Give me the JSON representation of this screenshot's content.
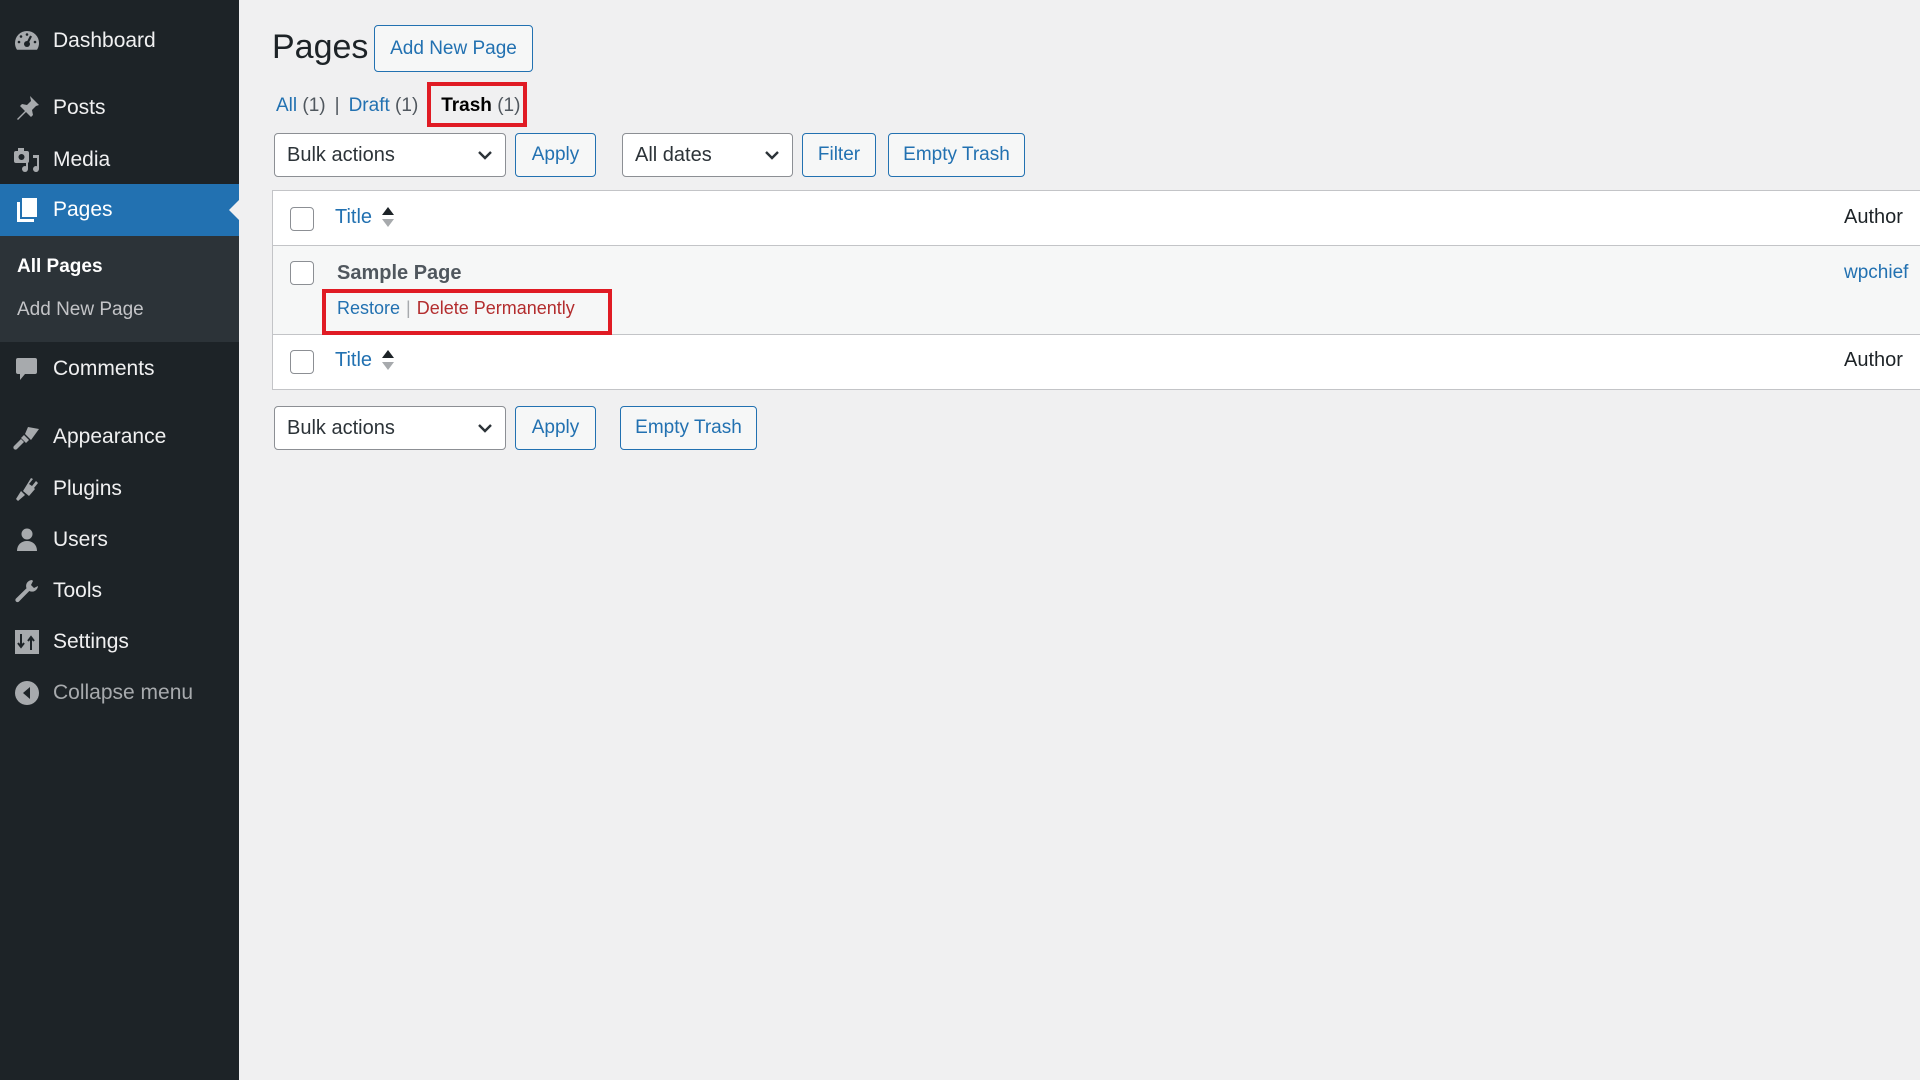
{
  "sidebar": {
    "items": [
      {
        "label": "Dashboard",
        "icon": "dashboard-icon"
      },
      {
        "label": "Posts",
        "icon": "pushpin-icon"
      },
      {
        "label": "Media",
        "icon": "media-icon"
      },
      {
        "label": "Pages",
        "icon": "pages-icon",
        "active": true
      },
      {
        "label": "Comments",
        "icon": "comment-icon"
      },
      {
        "label": "Appearance",
        "icon": "paintbrush-icon"
      },
      {
        "label": "Plugins",
        "icon": "plug-icon"
      },
      {
        "label": "Users",
        "icon": "user-icon"
      },
      {
        "label": "Tools",
        "icon": "wrench-icon"
      },
      {
        "label": "Settings",
        "icon": "sliders-icon"
      }
    ],
    "submenu": [
      {
        "label": "All Pages",
        "current": true
      },
      {
        "label": "Add New Page"
      }
    ],
    "collapse_label": "Collapse menu"
  },
  "header": {
    "title": "Pages",
    "add_new_label": "Add New Page"
  },
  "filters": {
    "all": {
      "label": "All",
      "count": "(1)"
    },
    "draft": {
      "label": "Draft",
      "count": "(1)"
    },
    "trash": {
      "label": "Trash",
      "count": "(1)",
      "current": true
    },
    "separator": "|"
  },
  "toolbar_top": {
    "bulk_actions": "Bulk actions",
    "apply": "Apply",
    "dates": "All dates",
    "filter": "Filter",
    "empty_trash": "Empty Trash"
  },
  "table": {
    "columns": {
      "title": "Title",
      "author": "Author"
    },
    "rows": [
      {
        "title": "Sample Page",
        "author": "wpchief",
        "actions": {
          "restore": "Restore",
          "separator": "|",
          "delete": "Delete Permanently"
        }
      }
    ]
  },
  "toolbar_bottom": {
    "bulk_actions": "Bulk actions",
    "apply": "Apply",
    "empty_trash": "Empty Trash"
  },
  "colors": {
    "sidebar_bg": "#1d2327",
    "accent": "#2271b1",
    "delete": "#b32d2e",
    "highlight": "#e01b24"
  }
}
